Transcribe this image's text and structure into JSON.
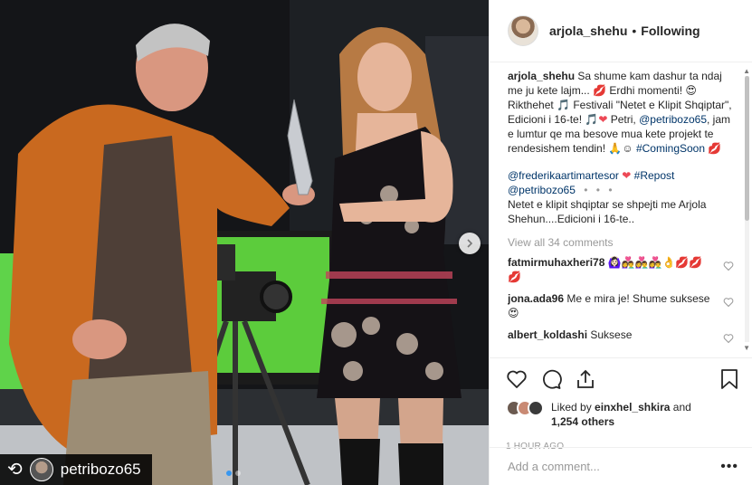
{
  "post": {
    "username": "arjola_shehu",
    "separator": "•",
    "follow_status": "Following"
  },
  "caption": {
    "username": "arjola_shehu",
    "part1": "Sa shume kam dashur ta ndaj me ju kete lajm...",
    "part2": "Erdhi momenti!",
    "part3": "Rikthehet",
    "part4": "Festivali \"Netet e Klipit Shqiptar\", Edicioni i 16-te!",
    "part5": "Petri,",
    "mention": "@petribozo65",
    "part6": ", jam e lumtur qe ma besove mua kete projekt te rendesishem tendin!",
    "hashtag": "#ComingSoon"
  },
  "repost_comment": {
    "mention1": "@frederikaartimartesor",
    "hashtag": "#Repost",
    "mention2": "@petribozo65",
    "more": "• • •",
    "text": "Netet e klipit shqiptar se shpejti me Arjola Shehun....Edicioni i 16-te.."
  },
  "view_all": "View all 34 comments",
  "comments": [
    {
      "username": "fatmirmuhaxheri78",
      "text": "🙆🏻‍♀️👩‍❤️‍👨👩‍❤️‍👨👩‍❤️‍👨👌💋💋💋"
    },
    {
      "username": "jona.ada96",
      "text": "Me e mira je! Shume suksese😍"
    },
    {
      "username": "albert_koldashi",
      "text": "Suksese"
    }
  ],
  "likes": {
    "prefix": "Liked by",
    "user": "einxhel_shkira",
    "conjunction": "and",
    "others": "1,254 others"
  },
  "timestamp": "1 HOUR AGO",
  "add_comment_placeholder": "Add a comment...",
  "options_glyph": "•••",
  "repost_badge": {
    "glyph": "⟲",
    "username": "petribozo65"
  },
  "colors": {
    "link": "#003569",
    "heart": "#ed4956",
    "carousel_active": "#3897f0"
  }
}
